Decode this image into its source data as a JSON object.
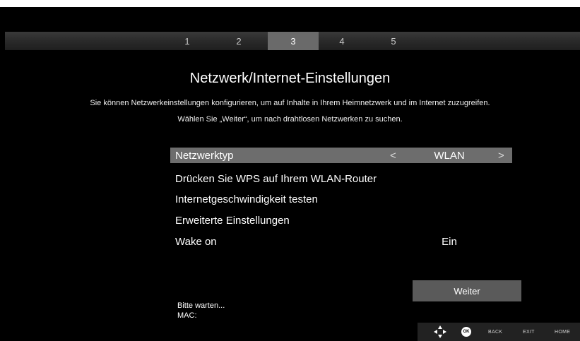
{
  "steps": [
    "1",
    "2",
    "3",
    "4",
    "5"
  ],
  "active_step": "3",
  "title": "Netzwerk/Internet-Einstellungen",
  "description_line1": "Sie können Netzwerkeinstellungen konfigurieren, um auf Inhalte in Ihrem Heimnetzwerk und im Internet zuzugreifen.",
  "description_line2": "Wählen Sie „Weiter“, um nach drahtlosen Netzwerken zu suchen.",
  "menu": {
    "network_type": {
      "label": "Netzwerktyp",
      "value": "WLAN",
      "left_arrow": "<",
      "right_arrow": ">"
    },
    "wps": {
      "label": "Drücken Sie WPS auf Ihrem WLAN-Router"
    },
    "speed_test": {
      "label": "Internetgeschwindigkeit testen"
    },
    "advanced": {
      "label": "Erweiterte Einstellungen"
    },
    "wake_on": {
      "label": "Wake on",
      "value": "Ein"
    }
  },
  "weiter_label": "Weiter",
  "status": {
    "waiting": "Bitte warten...",
    "mac": "MAC:"
  },
  "footer": {
    "ok": "OK",
    "back": "BACK",
    "exit": "EXIT",
    "home": "HOME"
  },
  "icons": {
    "dpad": "dpad-icon",
    "ok": "ok-button-icon"
  },
  "colors": {
    "background": "#000000",
    "selected_row": "#6d6d6d",
    "active_step": "#6a6a6a"
  }
}
